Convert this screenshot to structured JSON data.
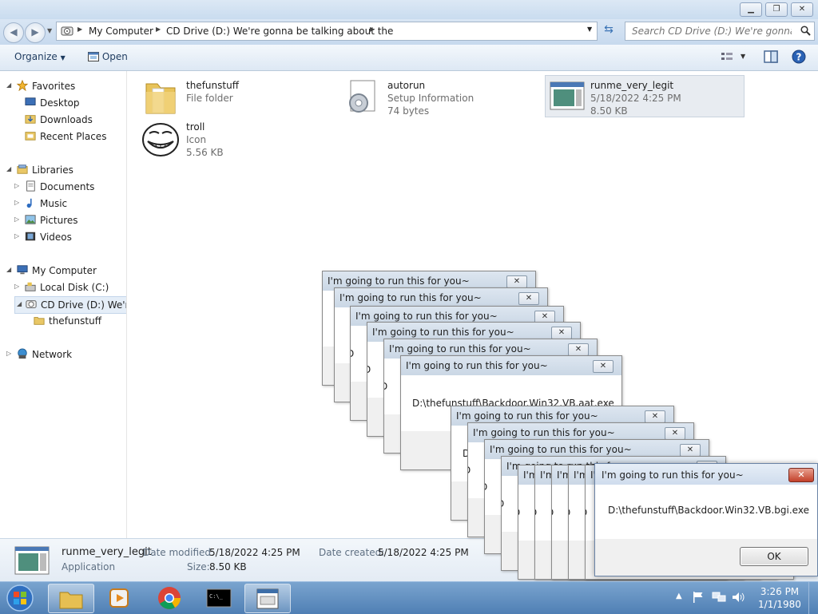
{
  "window": {
    "minimize_glyph": "▁",
    "maximize_glyph": "❐",
    "close_glyph": "✕"
  },
  "address": {
    "crumbs": [
      "My Computer",
      "CD Drive (D:) We're gonna be talking about the"
    ],
    "search_placeholder": "Search CD Drive (D:) We're gonna be ..."
  },
  "commands": {
    "organize": "Organize",
    "open": "Open"
  },
  "nav": {
    "favorites": "Favorites",
    "desktop": "Desktop",
    "downloads": "Downloads",
    "recent_places": "Recent Places",
    "libraries": "Libraries",
    "documents": "Documents",
    "music": "Music",
    "pictures": "Pictures",
    "videos": "Videos",
    "my_computer": "My Computer",
    "local_disk": "Local Disk (C:)",
    "cd_drive": "CD Drive (D:) We're g",
    "thefunstuff": "thefunstuff",
    "network": "Network"
  },
  "files": [
    {
      "name": "thefunstuff",
      "type": "File folder",
      "size": ""
    },
    {
      "name": "autorun",
      "type": "Setup Information",
      "size": "74 bytes"
    },
    {
      "name": "runme_very_legit",
      "type": "5/18/2022 4:25 PM",
      "size": "8.50 KB"
    },
    {
      "name": "troll",
      "type": "Icon",
      "size": "5.56 KB"
    }
  ],
  "details": {
    "name": "runme_very_legit",
    "type": "Application",
    "modified_label": "Date modified:",
    "modified_value": "5/18/2022 4:25 PM",
    "created_label": "Date created:",
    "created_value": "5/18/2022 4:25 PM",
    "size_label": "Size:",
    "size_value": "8.50 KB"
  },
  "dialogs": {
    "title": "I'm going to run this for you~",
    "message_back": "D:\\thefunstuff\\Backdoor.Win32.VB.aat.exe",
    "message_front": "D:\\thefunstuff\\Backdoor.Win32.VB.bgi.exe",
    "ok": "OK",
    "partial_letter": "D"
  },
  "clock": {
    "time": "3:26 PM",
    "date": "1/1/1980"
  }
}
